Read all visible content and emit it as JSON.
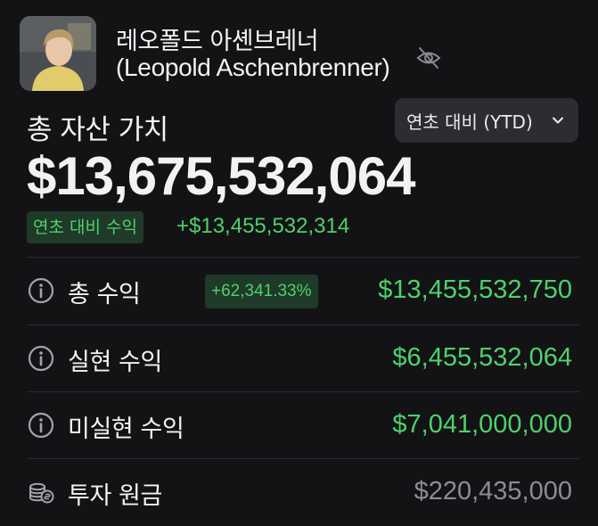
{
  "profile": {
    "name_ko": "레오폴드 아셴브레너",
    "name_en": "(Leopold Aschenbrenner)",
    "visibility_icon": "eye-slash-icon"
  },
  "period_selector": {
    "label": "연초 대비 (YTD)",
    "icon": "chevron-down-icon"
  },
  "total": {
    "label": "총 자산 가치",
    "value": "$13,675,532,064",
    "ytd_badge": "연초 대비 수익",
    "ytd_change": "+$13,455,532,314"
  },
  "rows": [
    {
      "icon": "info-icon",
      "label": "총 수익",
      "badge": "+62,341.33%",
      "value": "$13,455,532,750"
    },
    {
      "icon": "info-icon",
      "label": "실현 수익",
      "value": "$6,455,532,064"
    },
    {
      "icon": "info-icon",
      "label": "미실현 수익",
      "value": "$7,041,000,000"
    },
    {
      "icon": "coins-icon",
      "label": "투자 원금",
      "value": "$220,435,000"
    }
  ],
  "colors": {
    "background": "#131316",
    "positive": "#4fd06b",
    "positive_badge_bg": "#1f3a28",
    "muted": "#8c8c92",
    "button_bg": "#2c2c31"
  }
}
